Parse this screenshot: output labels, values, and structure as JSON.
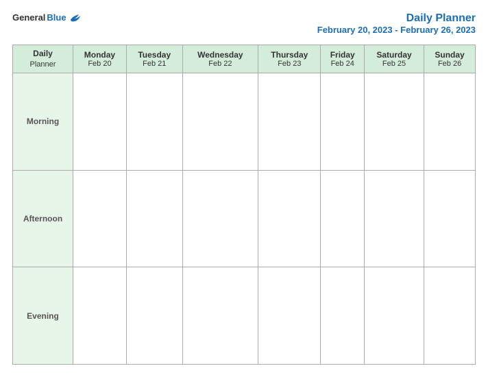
{
  "header": {
    "logo_general": "General",
    "logo_blue": "Blue",
    "title": "Daily Planner",
    "date_range": "February 20, 2023 - February 26, 2023"
  },
  "columns": [
    {
      "id": "label",
      "day": "Daily",
      "day2": "Planner",
      "date": ""
    },
    {
      "id": "mon",
      "day": "Monday",
      "date": "Feb 20"
    },
    {
      "id": "tue",
      "day": "Tuesday",
      "date": "Feb 21"
    },
    {
      "id": "wed",
      "day": "Wednesday",
      "date": "Feb 22"
    },
    {
      "id": "thu",
      "day": "Thursday",
      "date": "Feb 23"
    },
    {
      "id": "fri",
      "day": "Friday",
      "date": "Feb 24"
    },
    {
      "id": "sat",
      "day": "Saturday",
      "date": "Feb 25"
    },
    {
      "id": "sun",
      "day": "Sunday",
      "date": "Feb 26"
    }
  ],
  "rows": [
    {
      "id": "morning",
      "label": "Morning"
    },
    {
      "id": "afternoon",
      "label": "Afternoon"
    },
    {
      "id": "evening",
      "label": "Evening"
    }
  ]
}
